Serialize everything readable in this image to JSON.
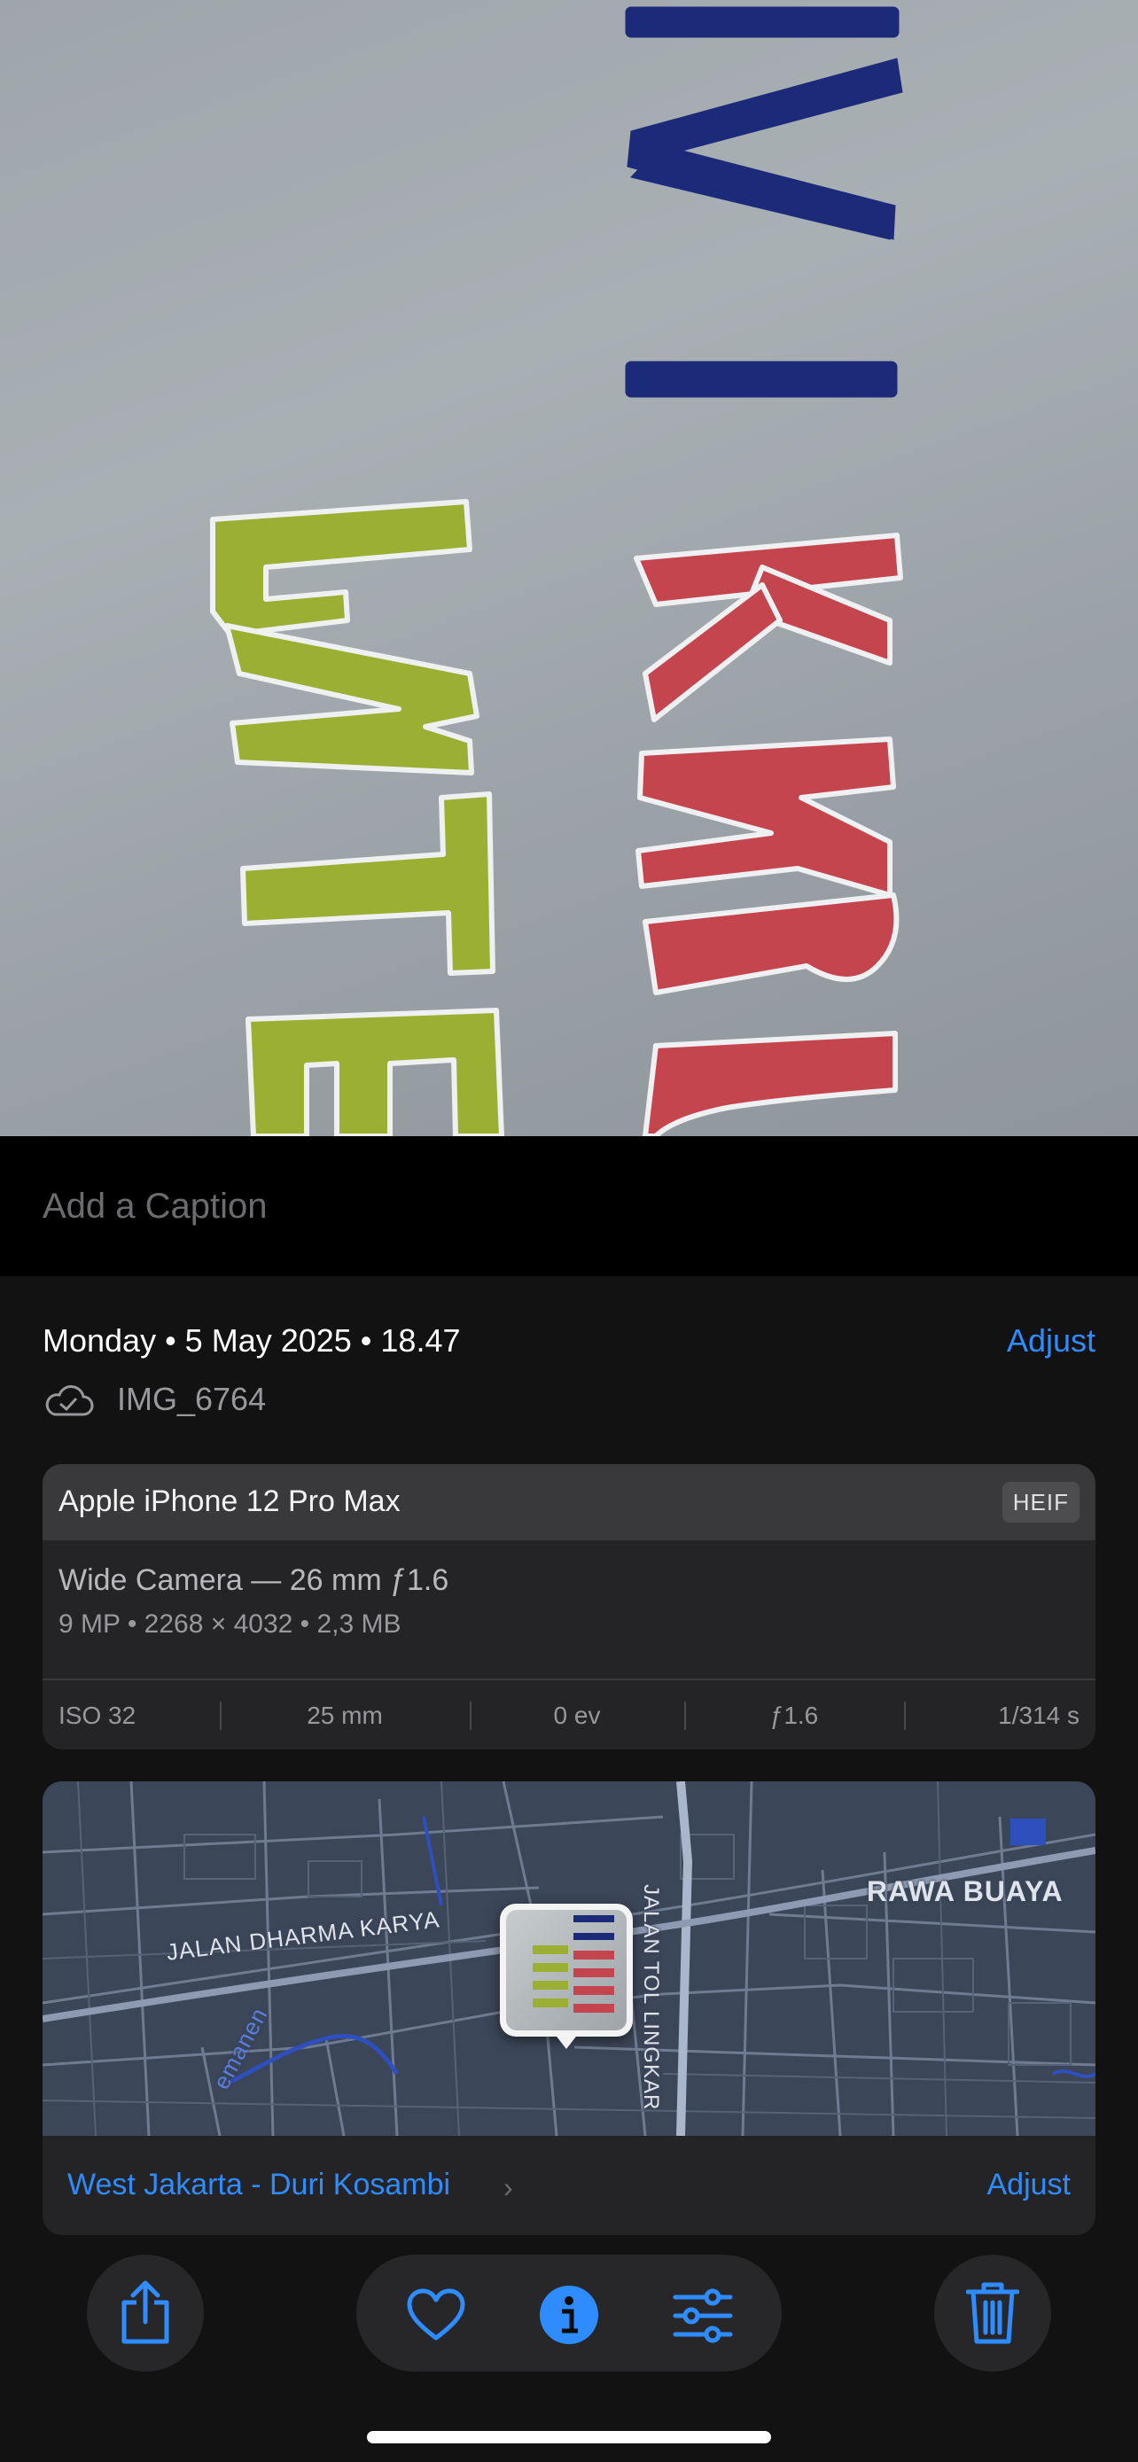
{
  "photo": {
    "description_icon": "photo-content",
    "text_rows": [
      "WI",
      "KAKU",
      "FATE"
    ]
  },
  "caption": {
    "placeholder": "Add a Caption"
  },
  "info": {
    "date": "Monday • 5 May 2025 • 18.47",
    "adjust_label": "Adjust",
    "file_icon": "icloud-icon",
    "file_name": "IMG_6764"
  },
  "device": {
    "name": "Apple iPhone 12 Pro Max",
    "format": "HEIF",
    "lens": "Wide Camera — 26 mm ƒ1.6",
    "specs": "9 MP  •  2268 × 4032  •  2,3 MB",
    "exif": [
      "ISO 32",
      "25 mm",
      "0 ev",
      "ƒ1.6",
      "1/314 s"
    ]
  },
  "map": {
    "labels": {
      "area": "RAWA BUAYA",
      "road1": "JALAN DHARMA KARYA",
      "road2": "JALAN TOL LINGKAR",
      "road3": "emanen"
    },
    "location": "West Jakarta - Duri Kosambi",
    "adjust_label": "Adjust",
    "colors": {
      "map_bg": "#3b4658",
      "road": "#7f8ba0",
      "water": "#2f4fbf"
    }
  },
  "toolbar": {
    "icons": [
      "share-icon",
      "heart-icon",
      "info-icon",
      "adjustments-icon",
      "trash-icon"
    ],
    "accent": "#2f8cff"
  }
}
